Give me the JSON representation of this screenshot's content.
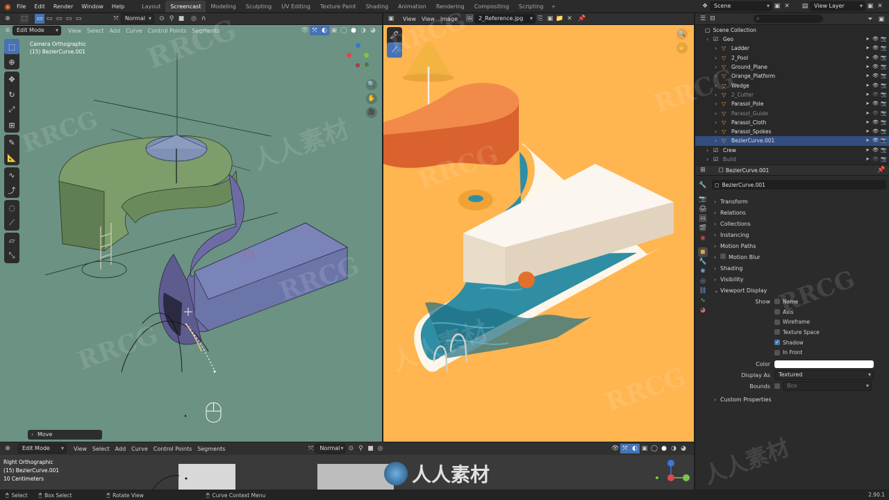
{
  "top_menu": [
    "File",
    "Edit",
    "Render",
    "Window",
    "Help"
  ],
  "workspaces": [
    "Layout",
    "Screencast",
    "Modeling",
    "Sculpting",
    "UV Editing",
    "Texture Paint",
    "Shading",
    "Animation",
    "Rendering",
    "Compositing",
    "Scripting"
  ],
  "active_workspace": "Screencast",
  "plus_label": "+",
  "topbar_right": {
    "scene": "Scene",
    "view_layer": "View Layer"
  },
  "toolbar_top": {
    "orientation": "Normal"
  },
  "viewport": {
    "mode": "Edit Mode",
    "menus": [
      "View",
      "Select",
      "Add",
      "Curve",
      "Control Points",
      "Segments"
    ],
    "camera_label": "Camera Orthographic",
    "object_label": "(15) BezierCurve.001",
    "operator_panel": "Move"
  },
  "image_editor": {
    "menus": [
      "View",
      "View",
      "Image"
    ],
    "image_name": "2_Reference.jpg"
  },
  "bottom_viewport": {
    "mode": "Edit Mode",
    "menus": [
      "View",
      "Select",
      "Add",
      "Curve",
      "Control Points",
      "Segments"
    ],
    "orientation": "Normal",
    "view_label": "Right Orthographic",
    "object_label": "(15) BezierCurve.001",
    "scale_label": "10 Centimeters"
  },
  "status_bar": {
    "select": "Select",
    "box_select": "Box Select",
    "rotate": "Rotate View",
    "context": "Curve Context Menu",
    "version": "2.90.1"
  },
  "outliner": {
    "header": "Scene Collection",
    "rows": [
      {
        "name": "Geo",
        "indent": 1,
        "dim": false,
        "sel": false
      },
      {
        "name": "Ladder",
        "indent": 2,
        "dim": false,
        "sel": false
      },
      {
        "name": "2_Pool",
        "indent": 2,
        "dim": false,
        "sel": false
      },
      {
        "name": "Ground_Plane",
        "indent": 2,
        "dim": false,
        "sel": false
      },
      {
        "name": "Orange_Platform",
        "indent": 2,
        "dim": false,
        "sel": false
      },
      {
        "name": "Wedge",
        "indent": 2,
        "dim": false,
        "sel": false
      },
      {
        "name": "2_Cutter",
        "indent": 2,
        "dim": true,
        "sel": false
      },
      {
        "name": "Parasol_Pole",
        "indent": 2,
        "dim": false,
        "sel": false
      },
      {
        "name": "Parasol_Guide",
        "indent": 2,
        "dim": true,
        "sel": false
      },
      {
        "name": "Parasol_Cloth",
        "indent": 2,
        "dim": false,
        "sel": false
      },
      {
        "name": "Parasol_Spokes",
        "indent": 2,
        "dim": false,
        "sel": false
      },
      {
        "name": "BezierCurve.001",
        "indent": 2,
        "dim": false,
        "sel": true
      },
      {
        "name": "Crew",
        "indent": 1,
        "dim": false,
        "sel": false
      },
      {
        "name": "Build",
        "indent": 1,
        "dim": true,
        "sel": false
      }
    ]
  },
  "properties": {
    "object_name": "BezierCurve.001",
    "datablock": "BezierCurve.001",
    "sections": [
      "Transform",
      "Relations",
      "Collections",
      "Instancing",
      "Motion Paths",
      "Motion Blur",
      "Shading",
      "Visibility",
      "Viewport Display"
    ],
    "show_label": "Show",
    "show_items": [
      {
        "label": "Name",
        "checked": false
      },
      {
        "label": "Axis",
        "checked": false
      },
      {
        "label": "Wireframe",
        "checked": false
      },
      {
        "label": "Texture Space",
        "checked": false
      },
      {
        "label": "Shadow",
        "checked": true
      },
      {
        "label": "In Front",
        "checked": false
      }
    ],
    "color_label": "Color",
    "display_as_label": "Display As",
    "display_as_value": "Textured",
    "bounds_label": "Bounds",
    "bounds_value": "Box",
    "custom_props": "Custom Properties"
  },
  "watermark": {
    "latin": "RRCG",
    "cjk": "人人素材"
  },
  "colors": {
    "viewport_bg": "#6b9282",
    "reference_bg": "#ffb550",
    "accent": "#4772b3",
    "pool_water": "#2f8ea3"
  }
}
